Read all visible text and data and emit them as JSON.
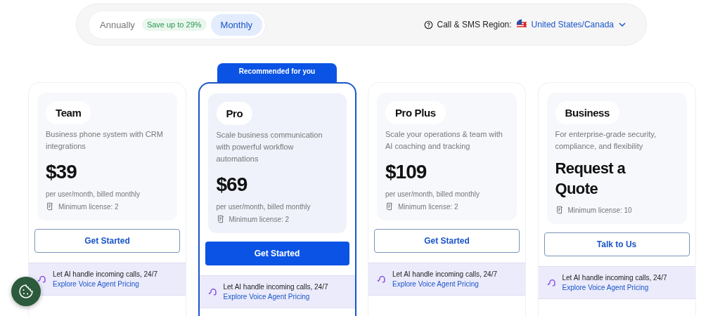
{
  "billing_toggle": {
    "options": [
      {
        "label": "Annually",
        "badge": "Save up to 29%",
        "selected": false
      },
      {
        "label": "Monthly",
        "selected": true
      }
    ]
  },
  "region": {
    "label": "Call & SMS Region:",
    "value": "United States/Canada"
  },
  "plans": [
    {
      "name": "Team",
      "recommended": false,
      "description": "Business phone system with CRM integrations",
      "kind": "amount",
      "price": "$39",
      "price_note": "per user/month, billed monthly",
      "min_license": "Minimum license: 2",
      "button": {
        "label": "Get Started",
        "kind": "outline"
      },
      "promo": {
        "text": "Let AI handle incoming calls, 24/7",
        "link": "Explore Voice Agent Pricing"
      }
    },
    {
      "name": "Pro",
      "recommended": true,
      "badge": "Recommended for you",
      "description": "Scale business communication with powerful workflow automations",
      "kind": "amount",
      "price": "$69",
      "price_note": "per user/month, billed monthly",
      "min_license": "Minimum license: 2",
      "button": {
        "label": "Get Started",
        "kind": "primary"
      },
      "promo": {
        "text": "Let AI handle incoming calls, 24/7",
        "link": "Explore Voice Agent Pricing"
      }
    },
    {
      "name": "Pro Plus",
      "recommended": false,
      "description": "Scale your operations & team with AI coaching and tracking",
      "kind": "amount",
      "price": "$109",
      "price_note": "per user/month, billed monthly",
      "min_license": "Minimum license: 2",
      "button": {
        "label": "Get Started",
        "kind": "outline"
      },
      "promo": {
        "text": "Let AI handle incoming calls, 24/7",
        "link": "Explore Voice Agent Pricing"
      }
    },
    {
      "name": "Business",
      "recommended": false,
      "description": "For enterprise-grade security, compliance, and flexibility",
      "kind": "quote",
      "price": "Request a Quote",
      "min_license": "Minimum license: 10",
      "button": {
        "label": "Talk to Us",
        "kind": "outline"
      },
      "promo": {
        "text": "Let AI handle incoming calls, 24/7",
        "link": "Explore Voice Agent Pricing"
      }
    }
  ]
}
